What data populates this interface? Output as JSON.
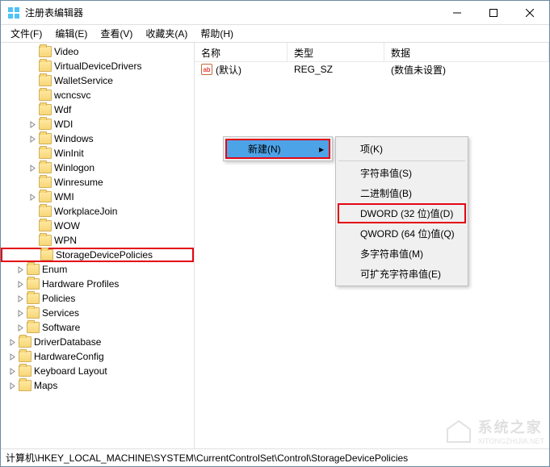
{
  "window": {
    "title": "注册表编辑器"
  },
  "menubar": {
    "items": [
      "文件(F)",
      "编辑(E)",
      "查看(V)",
      "收藏夹(A)",
      "帮助(H)"
    ]
  },
  "tree": {
    "items": [
      {
        "label": "Video",
        "indent": 25
      },
      {
        "label": "VirtualDeviceDrivers",
        "indent": 25
      },
      {
        "label": "WalletService",
        "indent": 25
      },
      {
        "label": "wcncsvc",
        "indent": 25
      },
      {
        "label": "Wdf",
        "indent": 25
      },
      {
        "label": "WDI",
        "indent": 25,
        "expander": true
      },
      {
        "label": "Windows",
        "indent": 25,
        "expander": true
      },
      {
        "label": "WinInit",
        "indent": 25
      },
      {
        "label": "Winlogon",
        "indent": 25,
        "expander": true
      },
      {
        "label": "Winresume",
        "indent": 25
      },
      {
        "label": "WMI",
        "indent": 25,
        "expander": true
      },
      {
        "label": "WorkplaceJoin",
        "indent": 25
      },
      {
        "label": "WOW",
        "indent": 25
      },
      {
        "label": "WPN",
        "indent": 25
      },
      {
        "label": "StorageDevicePolicies",
        "indent": 25,
        "highlight": true
      },
      {
        "label": "Enum",
        "indent": 10,
        "expander": true
      },
      {
        "label": "Hardware Profiles",
        "indent": 10,
        "expander": true
      },
      {
        "label": "Policies",
        "indent": 10,
        "expander": true
      },
      {
        "label": "Services",
        "indent": 10,
        "expander": true
      },
      {
        "label": "Software",
        "indent": 10,
        "expander": true
      },
      {
        "label": "DriverDatabase",
        "indent": 0,
        "expander": true
      },
      {
        "label": "HardwareConfig",
        "indent": 0,
        "expander": true
      },
      {
        "label": "Keyboard Layout",
        "indent": 0,
        "expander": true
      },
      {
        "label": "Maps",
        "indent": 0,
        "expander": true
      }
    ]
  },
  "list": {
    "columns": {
      "name": "名称",
      "type": "类型",
      "data": "数据"
    },
    "row": {
      "name": "(默认)",
      "type": "REG_SZ",
      "data": "(数值未设置)"
    }
  },
  "context": {
    "new_label": "新建(N)",
    "submenu": [
      {
        "label": "项(K)"
      },
      {
        "divider": true
      },
      {
        "label": "字符串值(S)"
      },
      {
        "label": "二进制值(B)"
      },
      {
        "label": "DWORD (32 位)值(D)",
        "highlight": true
      },
      {
        "label": "QWORD (64 位)值(Q)"
      },
      {
        "label": "多字符串值(M)"
      },
      {
        "label": "可扩充字符串值(E)"
      }
    ]
  },
  "statusbar": {
    "path": "计算机\\HKEY_LOCAL_MACHINE\\SYSTEM\\CurrentControlSet\\Control\\StorageDevicePolicies"
  },
  "watermark": {
    "text": "系统之家",
    "sub": "XITONGZHIJIA.NET"
  }
}
